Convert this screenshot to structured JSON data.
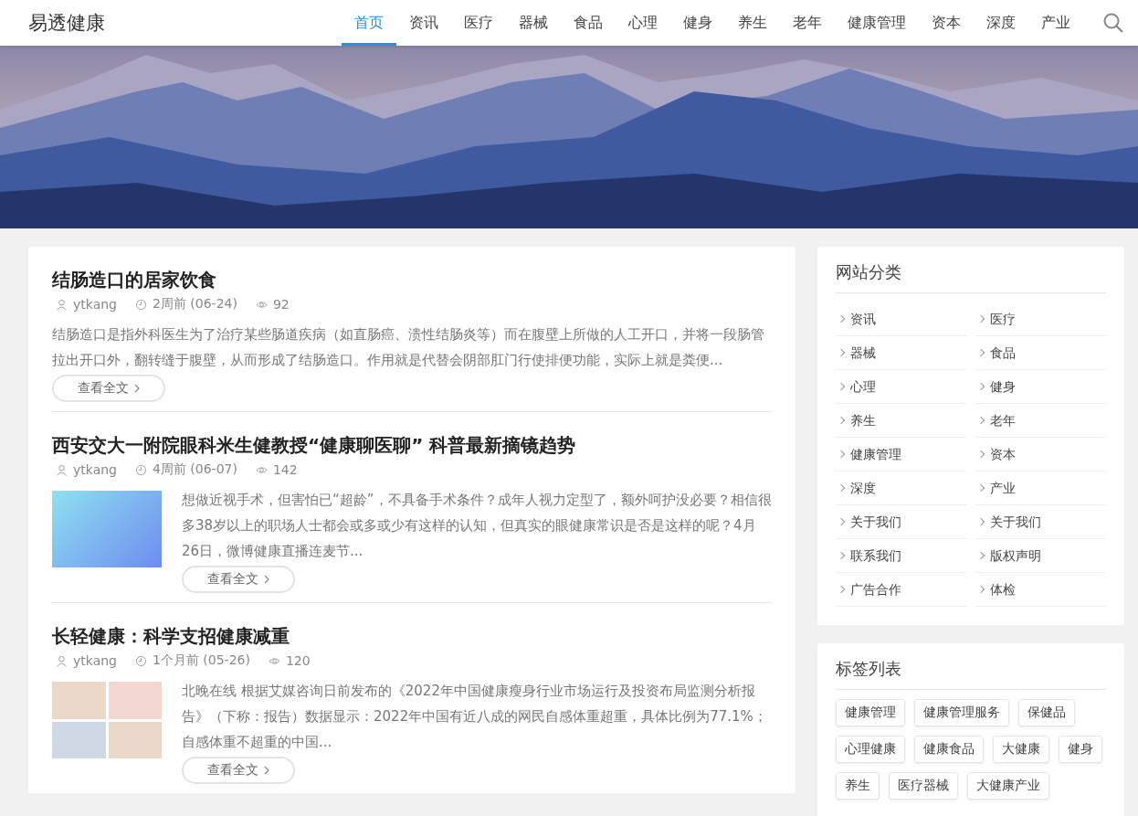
{
  "header": {
    "logo": "易透健康",
    "nav": [
      {
        "label": "首页",
        "selected": true
      },
      {
        "label": "资讯",
        "selected": false
      },
      {
        "label": "医疗",
        "selected": false
      },
      {
        "label": "器械",
        "selected": false
      },
      {
        "label": "食品",
        "selected": false
      },
      {
        "label": "心理",
        "selected": false
      },
      {
        "label": "健身",
        "selected": false
      },
      {
        "label": "养生",
        "selected": false
      },
      {
        "label": "老年",
        "selected": false
      },
      {
        "label": "健康管理",
        "selected": false
      },
      {
        "label": "资本",
        "selected": false
      },
      {
        "label": "深度",
        "selected": false
      },
      {
        "label": "产业",
        "selected": false
      }
    ]
  },
  "articles": [
    {
      "title": "结肠造口的居家饮食",
      "author": "ytkang",
      "date": "2周前 (06-24)",
      "views": "92",
      "kind": "text",
      "excerpt": "结肠造口是指外科医生为了治疗某些肠道疾病（如直肠癌、溃性结肠炎等）而在腹壁上所做的人工开口，并将一段肠管拉出开口外，翻转缝于腹壁，从而形成了结肠造口。作用就是代替会阴部肛门行使排便功能，实际上就是粪便...",
      "more": "查看全文"
    },
    {
      "title": "西安交大一附院眼科米生健教授“健康聊医聊” 科普最新摘镜趋势",
      "author": "ytkang",
      "date": "4周前 (06-07)",
      "views": "142",
      "kind": "video",
      "excerpt": "想做近视手术，但害怕已“超龄”，不具备手术条件？成年人视力定型了，额外呵护没必要？相信很多38岁以上的职场人士都会或多或少有这样的认知，但真实的眼健康常识是否是这样的呢？4月26日，微博健康直播连麦节...",
      "more": "查看全文"
    },
    {
      "title": "长轻健康：科学支招健康减重",
      "author": "ytkang",
      "date": "1个月前 (05-26)",
      "views": "120",
      "kind": "collage",
      "excerpt": "北晚在线 根据艾媒咨询日前发布的《2022年中国健康瘦身行业市场运行及投资布局监测分析报告》（下称：报告）数据显示：2022年中国有近八成的网民自感体重超重，具体比例为77.1%；自感体重不超重的中国...",
      "more": "查看全文"
    }
  ],
  "sidebar": {
    "categories": {
      "title": "网站分类",
      "items": [
        "资讯",
        "医疗",
        "器械",
        "食品",
        "心理",
        "健身",
        "养生",
        "老年",
        "健康管理",
        "资本",
        "深度",
        "产业",
        "关于我们",
        "关于我们",
        "联系我们",
        "版权声明",
        "广告合作",
        "体检"
      ]
    },
    "tags": {
      "title": "标签列表",
      "items": [
        "健康管理",
        "健康管理服务",
        "保健品",
        "心理健康",
        "健康食品",
        "大健康",
        "健身",
        "养生",
        "医疗器械",
        "大健康产业"
      ]
    }
  }
}
